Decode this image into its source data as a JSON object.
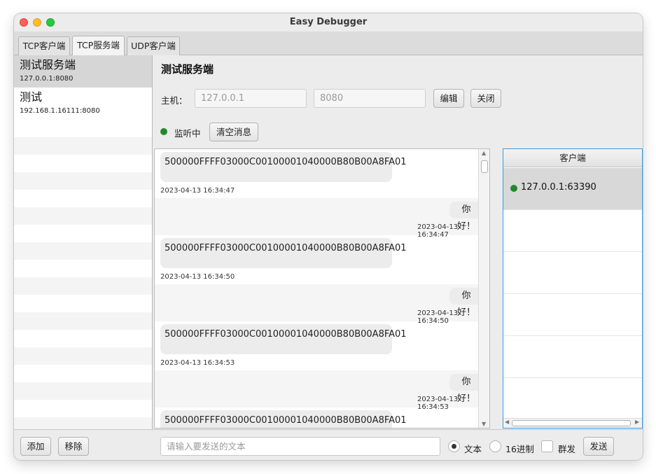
{
  "window": {
    "title": "Easy Debugger"
  },
  "tabs": [
    {
      "label": "TCP客户端"
    },
    {
      "label": "TCP服务端"
    },
    {
      "label": "UDP客户端"
    }
  ],
  "sidebar": {
    "servers": [
      {
        "name": "测试服务端",
        "address": "127.0.0.1:8080"
      },
      {
        "name": "测试",
        "address": "192.168.1.16111:8080"
      }
    ]
  },
  "main": {
    "title": "测试服务端",
    "host_label": "主机：",
    "host_value": "127.0.0.1",
    "port_value": "8080",
    "edit_label": "编辑",
    "close_label": "关闭",
    "status_text": "监听中",
    "clear_label": "清空消息"
  },
  "messages": [
    {
      "dir": "in",
      "text": "500000FFFF03000C00100001040000B80B00A8FA01",
      "time": "2023-04-13 16:34:47"
    },
    {
      "dir": "out",
      "text": "你好！",
      "time": "2023-04-13 16:34:47"
    },
    {
      "dir": "in",
      "text": "500000FFFF03000C00100001040000B80B00A8FA01",
      "time": "2023-04-13 16:34:50"
    },
    {
      "dir": "out",
      "text": "你好！",
      "time": "2023-04-13 16:34:50"
    },
    {
      "dir": "in",
      "text": "500000FFFF03000C00100001040000B80B00A8FA01",
      "time": "2023-04-13 16:34:53"
    },
    {
      "dir": "out",
      "text": "你好！",
      "time": "2023-04-13 16:34:53"
    },
    {
      "dir": "in",
      "text": "500000FFFF03000C00100001040000B80B00A8FA01",
      "time": ""
    }
  ],
  "clients": {
    "header": "客户端",
    "items": [
      {
        "address": "127.0.0.1:63390"
      }
    ]
  },
  "bottom": {
    "add_label": "添加",
    "remove_label": "移除",
    "input_placeholder": "请输入要发送的文本",
    "text_option": "文本",
    "hex_option": "16进制",
    "broadcast_option": "群发",
    "send_label": "发送",
    "selected_mode": "文本"
  },
  "colors": {
    "online": "#1e8a2a",
    "focus": "#3b9be0"
  }
}
